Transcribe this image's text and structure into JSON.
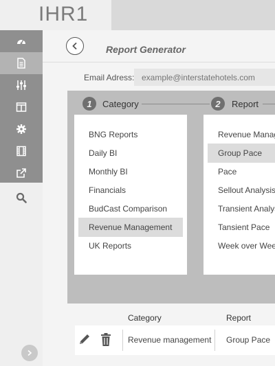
{
  "app": {
    "logo": "IHR1"
  },
  "sidebar": {
    "items": [
      {
        "name": "dashboard-icon"
      },
      {
        "name": "document-icon"
      },
      {
        "name": "sliders-icon"
      },
      {
        "name": "columns-icon"
      },
      {
        "name": "gear-icon"
      },
      {
        "name": "film-icon"
      },
      {
        "name": "external-link-icon"
      }
    ],
    "search": "search-icon",
    "expand": "chevron-right-icon"
  },
  "page": {
    "title": "Report Generator"
  },
  "email": {
    "label": "Email Adress:",
    "placeholder": "example@interstatehotels.com"
  },
  "steps": [
    {
      "number": "1",
      "label": "Category"
    },
    {
      "number": "2",
      "label": "Report"
    }
  ],
  "categories": [
    {
      "label": "BNG Reports"
    },
    {
      "label": "Daily BI"
    },
    {
      "label": "Monthly BI"
    },
    {
      "label": "Financials"
    },
    {
      "label": "BudCast Comparison"
    },
    {
      "label": "Revenue Management"
    },
    {
      "label": "UK Reports"
    }
  ],
  "categories_selected": "Revenue Management",
  "reports": [
    {
      "label": "Revenue Management"
    },
    {
      "label": "Group Pace"
    },
    {
      "label": "Pace"
    },
    {
      "label": "Sellout Analysis"
    },
    {
      "label": "Transient Analysis"
    },
    {
      "label": "Tansient Pace"
    },
    {
      "label": "Week over Week"
    }
  ],
  "reports_selected": "Group Pace",
  "summary": {
    "headers": {
      "category": "Category",
      "report": "Report"
    },
    "row": {
      "category": "Revenue management",
      "report": "Group Pace"
    }
  },
  "colors": {
    "sidebar_dark": "#8f8f8f",
    "panel": "#bdbdbd",
    "selected": "#dcdcdc"
  }
}
